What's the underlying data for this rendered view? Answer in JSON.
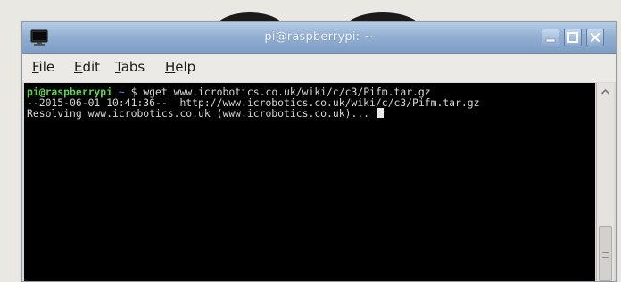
{
  "window": {
    "title": "pi@raspberrypi: ~",
    "icon": "terminal-icon",
    "buttons": [
      "minimize-icon",
      "maximize-icon",
      "close-icon"
    ]
  },
  "menu": {
    "file": {
      "accel": "F",
      "rest": "ile"
    },
    "edit": {
      "accel": "E",
      "rest": "dit"
    },
    "tabs": {
      "accel": "T",
      "rest": "abs"
    },
    "help": {
      "accel": "H",
      "rest": "elp"
    }
  },
  "terminal": {
    "prompt_user": "pi@raspberrypi",
    "prompt_dir": " ~ ",
    "prompt_symbol": "$ ",
    "command": "wget www.icrobotics.co.uk/wiki/c/c3/Pifm.tar.gz",
    "output_line_1": "--2015-06-01 10:41:36--  http://www.icrobotics.co.uk/wiki/c/c3/Pifm.tar.gz",
    "output_line_2": "Resolving www.icrobotics.co.uk (www.icrobotics.co.uk)... "
  },
  "colors": {
    "prompt_user": "#5bd34e",
    "prompt_dir": "#6d8fd8",
    "terminal_bg": "#000000",
    "titlebar": "#93b0d2"
  }
}
